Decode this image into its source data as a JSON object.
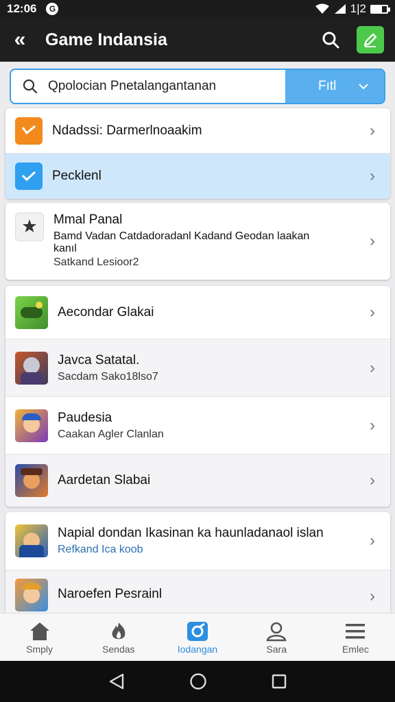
{
  "status_bar": {
    "time": "12:06",
    "notif_glyph": "G",
    "signal_text": "1|2"
  },
  "app_bar": {
    "back_glyph": "«",
    "title": "Game Indansia"
  },
  "search": {
    "value": "Qpolocian Pnetalangantanan",
    "filter_label": "Fıtl"
  },
  "list_top": [
    {
      "title": "Ndadssi: Darmerlnoaakim",
      "icon": "orange-check-icon",
      "color": "#f28a1e"
    },
    {
      "title": "Pecklenl",
      "icon": "blue-check-icon",
      "color": "#2f9ff0"
    }
  ],
  "info_card": {
    "title": "Mmal Panal",
    "line1": "Bamd Vadan Catdadoradanl Kadand Geodan laakan",
    "line2": "kanıl",
    "line3": "Satkand Lesioor2",
    "icon": "star-badge-icon"
  },
  "games": [
    {
      "title": "Aecondar Glakai",
      "subtitle": "",
      "icon": "green-game-icon",
      "colors": [
        "#3f8e2c",
        "#7dd34a"
      ]
    },
    {
      "title": "Javca Satatal.",
      "subtitle": "Sacdam Sako18lso7",
      "icon": "zombie-game-icon",
      "colors": [
        "#c45a2a",
        "#3a3a5e"
      ]
    },
    {
      "title": "Paudesia",
      "subtitle": "Caakan Agler Clanlan",
      "icon": "girl-game-icon",
      "colors": [
        "#7a3bb8",
        "#f0b23a"
      ]
    },
    {
      "title": "Aardetan Slabai",
      "subtitle": "",
      "icon": "pirate-game-icon",
      "colors": [
        "#2a4ea8",
        "#e07a2a"
      ]
    }
  ],
  "games_more": [
    {
      "title": "Napial dondan Ikasinan ka haunladanaol islan",
      "subtitle": "Refkand Ica koob",
      "subtitle_link": true,
      "icon": "knight-game-icon",
      "colors": [
        "#2c5fb5",
        "#f0c23a"
      ]
    },
    {
      "title": "Naroefen Pesrainl",
      "subtitle": "",
      "subtitle_link": false,
      "icon": "hero-game-icon",
      "colors": [
        "#3a8ee0",
        "#f39a3a"
      ]
    }
  ],
  "bottom_nav": [
    {
      "label": "Smply",
      "icon": "home-icon",
      "active": false
    },
    {
      "label": "Sendas",
      "icon": "fire-icon",
      "active": false
    },
    {
      "label": "Iodangan",
      "icon": "games-icon",
      "active": true
    },
    {
      "label": "Sara",
      "icon": "profile-icon",
      "active": false
    },
    {
      "label": "Emlec",
      "icon": "menu-icon",
      "active": false
    }
  ],
  "colors": {
    "accent": "#2c8fe0",
    "appbar": "#1f1f1f",
    "edit_button": "#4cc94a",
    "selected_row": "#cfe7fb"
  }
}
